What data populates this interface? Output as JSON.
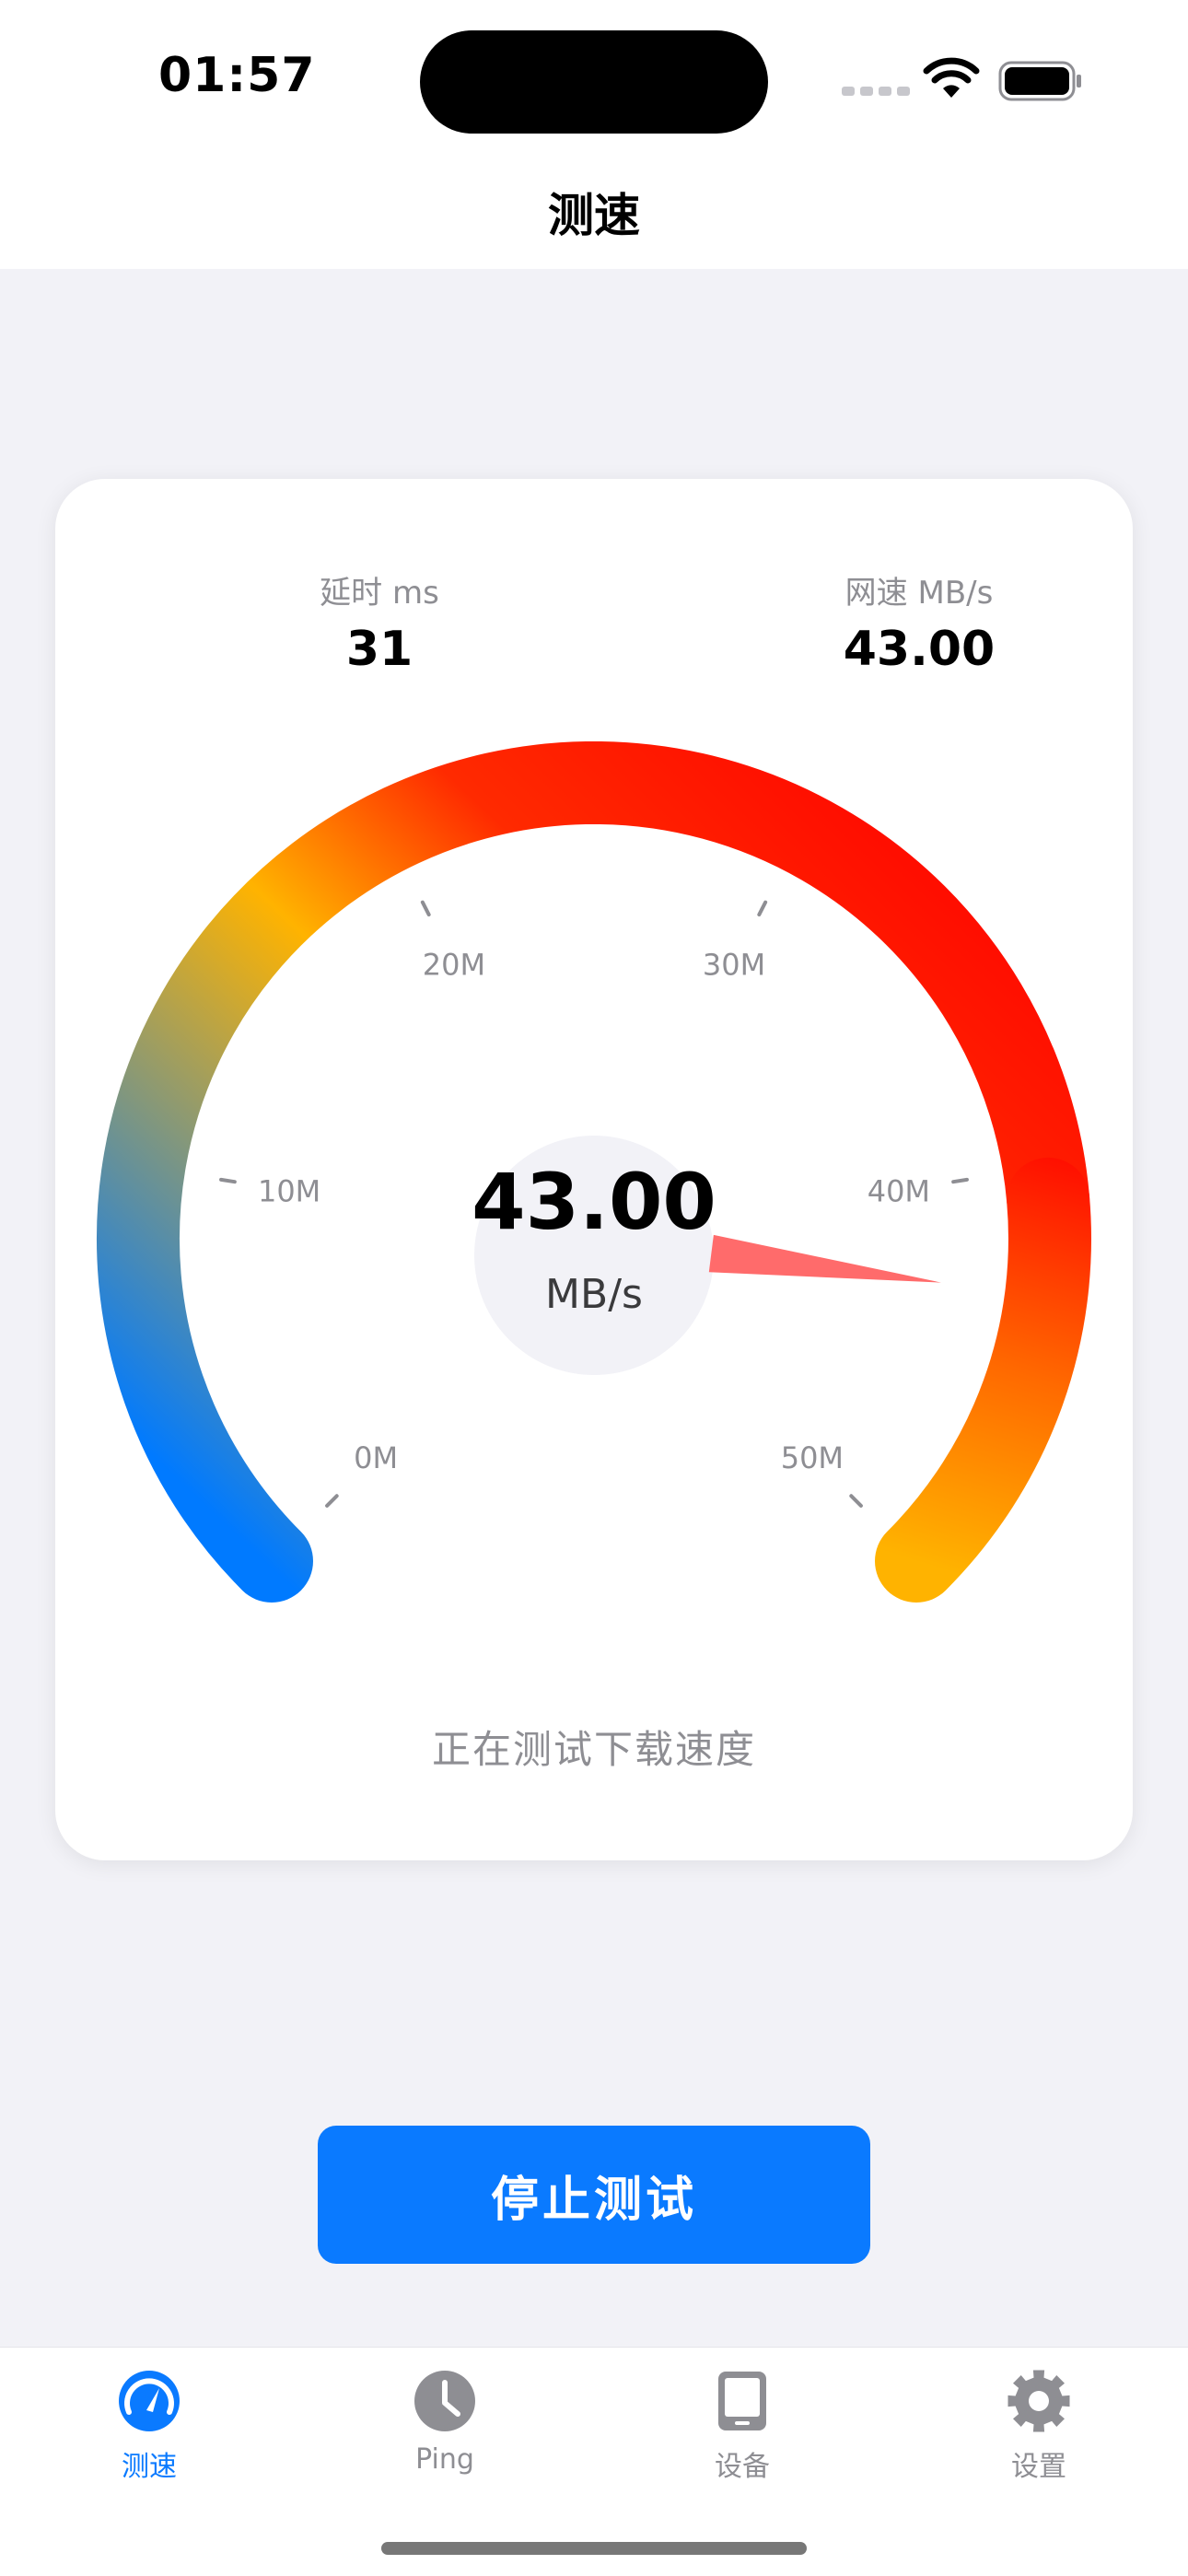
{
  "status_bar": {
    "time": "01:57"
  },
  "nav": {
    "title": "测速"
  },
  "stats": {
    "latency_label": "延时 ms",
    "latency_value": "31",
    "speed_label": "网速 MB/s",
    "speed_value": "43.00"
  },
  "gauge": {
    "value": "43.00",
    "unit": "MB/s",
    "reading": 43,
    "min": 0,
    "max": 50,
    "ticks": [
      "0M",
      "10M",
      "20M",
      "30M",
      "40M",
      "50M"
    ],
    "gradient_colors": [
      "#007aff",
      "#ffb300",
      "#ff2a00",
      "#ff0000",
      "#ff6a00",
      "#ffb300"
    ],
    "needle_color": "#ff6b6b"
  },
  "status_text": "正在测试下载速度",
  "button": {
    "stop_label": "停止测试"
  },
  "tabs": [
    {
      "label": "测速",
      "icon": "speedometer-icon",
      "active": true
    },
    {
      "label": "Ping",
      "icon": "clock-icon",
      "active": false
    },
    {
      "label": "设备",
      "icon": "tablet-icon",
      "active": false
    },
    {
      "label": "设置",
      "icon": "gear-icon",
      "active": false
    }
  ],
  "colors": {
    "accent": "#0a7aff",
    "background": "#f2f2f7"
  }
}
